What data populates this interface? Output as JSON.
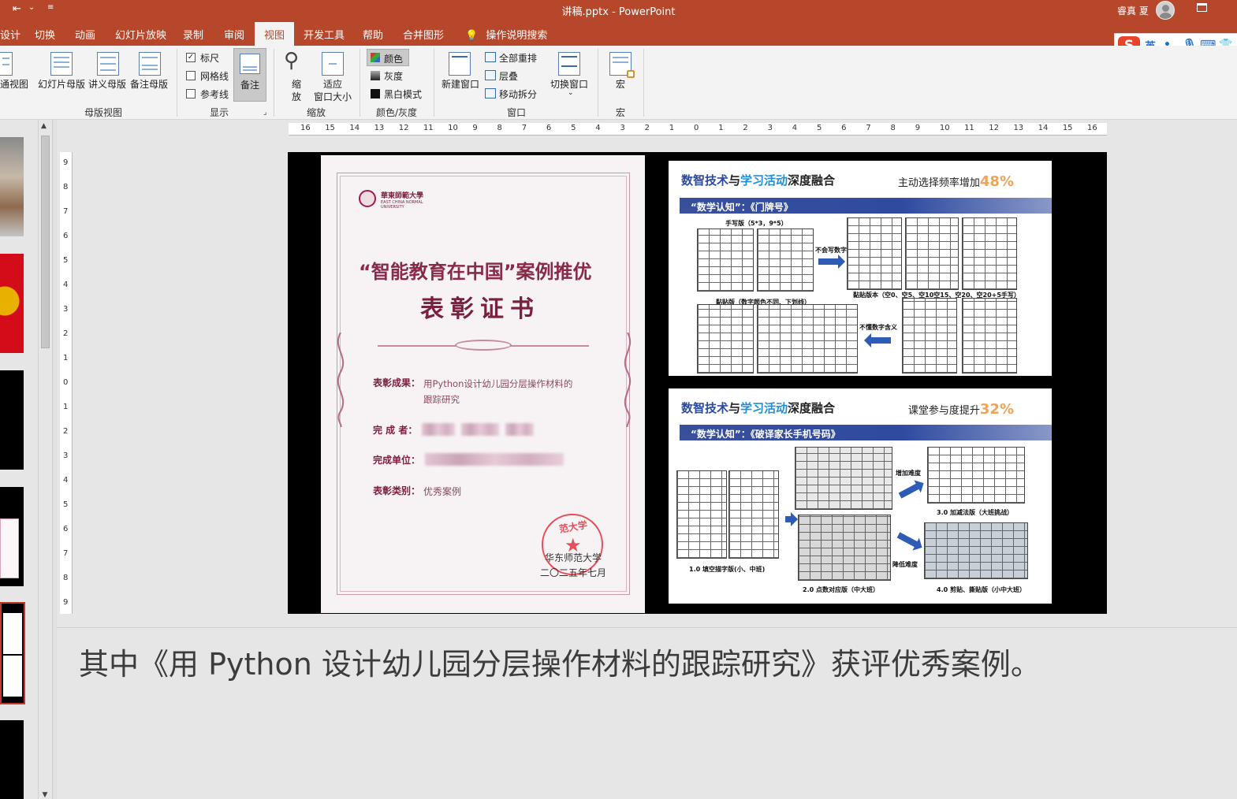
{
  "window": {
    "title": "讲稿.pptx  -  PowerPoint",
    "user": "睿真 夏"
  },
  "tabs": [
    "设计",
    "切换",
    "动画",
    "幻灯片放映",
    "录制",
    "审阅",
    "视图",
    "开发工具",
    "帮助",
    "合并图形"
  ],
  "active_tab": "视图",
  "tell_me": "操作说明搜索",
  "ime": {
    "logo": "S",
    "mode": "英",
    "punct": "•,"
  },
  "ribbon": {
    "master_views": {
      "normal_cut": "通视图",
      "slide_master": "幻灯片母版",
      "handout_master": "讲义母版",
      "notes_master": "备注母版",
      "group": "母版视图"
    },
    "show": {
      "ruler": "标尺",
      "gridlines": "网格线",
      "guides": "参考线",
      "notes": "备注",
      "group": "显示"
    },
    "zoom": {
      "zoom_line1": "缩",
      "zoom_line2": "放",
      "fit_line1": "适应",
      "fit_line2": "窗口大小",
      "group": "缩放"
    },
    "color": {
      "color": "颜色",
      "grayscale": "灰度",
      "bw": "黑白模式",
      "group": "颜色/灰度"
    },
    "window": {
      "new_window": "新建窗口",
      "arrange_all": "全部重排",
      "cascade": "层叠",
      "move_split": "移动拆分",
      "switch": "切换窗口",
      "group": "窗口"
    },
    "macros": {
      "macros": "宏",
      "group": "宏"
    }
  },
  "ruler_h": [
    "16",
    "15",
    "14",
    "13",
    "12",
    "11",
    "10",
    "9",
    "8",
    "7",
    "6",
    "5",
    "4",
    "3",
    "2",
    "1",
    "0",
    "1",
    "2",
    "3",
    "4",
    "5",
    "6",
    "7",
    "8",
    "9",
    "10",
    "11",
    "12",
    "13",
    "14",
    "15",
    "16"
  ],
  "ruler_v": [
    "9",
    "8",
    "7",
    "6",
    "5",
    "4",
    "3",
    "2",
    "1",
    "0",
    "1",
    "2",
    "3",
    "4",
    "5",
    "6",
    "7",
    "8",
    "9"
  ],
  "certificate": {
    "university_cn": "華東師範大學",
    "university_en": "EAST CHINA NORMAL UNIVERSITY",
    "heading": "“智能教育在中国”案例推优",
    "subheading": "表彰证书",
    "result_label": "表彰成果：",
    "result_value_1": "用Python设计幼儿园分层操作材料的",
    "result_value_2": "跟踪研究",
    "author_label": "完 成 者：",
    "org_label": "完成单位：",
    "category_label": "表彰类别：",
    "category_value": "优秀案例",
    "seal_text": "范大学",
    "issuer": "华东师范大学",
    "date": "二〇二五年七月"
  },
  "card1": {
    "title_a": "数智技术",
    "title_b": "与",
    "title_c": "学习活动",
    "title_d": "深度融合",
    "stat_label": "主动选择频率增加",
    "stat_value": "48%",
    "banner": "“数学认知”：《门牌号》",
    "lbl_hand": "手写版（5*3，9*5）",
    "lbl_cant": "不会写数字",
    "lbl_paste_versions": "黏贴版本（空0、空5、空10空15、空20、空20+5手写）",
    "lbl_paste": "黏贴版（数字颜色不同、下划线）",
    "lbl_dontknow": "不懂数字含义"
  },
  "card2": {
    "title_a": "数智技术",
    "title_b": "与",
    "title_c": "学习活动",
    "title_d": "深度融合",
    "stat_label": "课堂参与度提升",
    "stat_value": "32%",
    "banner": "“数学认知”：《破译家长手机号码》",
    "lbl_fill": "1.0  填空描字版(小、中班)",
    "lbl_dots": "2.0  点数对应版（中大班）",
    "lbl_addsub": "3.0  加减法版（大班挑战）",
    "lbl_cut": "4.0  剪贴、撕贴版（小中大班）",
    "lbl_harder": "增加难度",
    "lbl_easier": "降低难度"
  },
  "notes": {
    "text": "其中《用 Python 设计幼儿园分层操作材料的跟踪研究》获评优秀案例。"
  },
  "colors": {
    "accent": "#b7472a",
    "card_blue": "#2b4aa0",
    "stat_orange": "#f0a356",
    "cert_red": "#7a1f3d"
  }
}
